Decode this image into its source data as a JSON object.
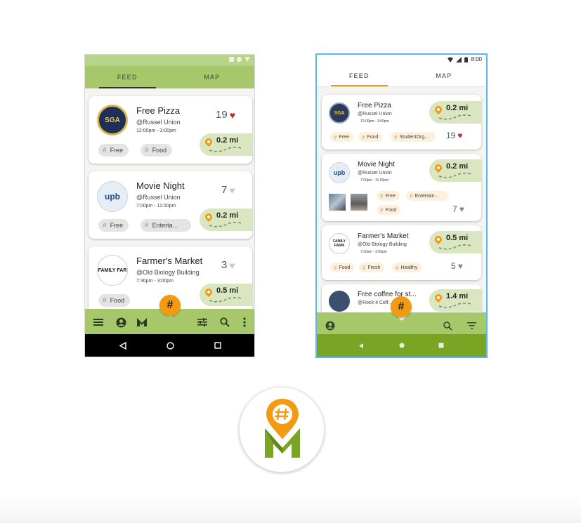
{
  "colors": {
    "accent_green": "#a6c86a",
    "orange": "#f29a12",
    "dark_green": "#7aa524",
    "like_red": "#c9242f",
    "selection_blue": "#5ab8ec"
  },
  "phone1": {
    "tabs": [
      {
        "label": "FEED",
        "active": true
      },
      {
        "label": "MAP",
        "active": false
      }
    ],
    "cards": [
      {
        "logo": "SGA",
        "title": "Free Pizza",
        "location": "@Russel Union",
        "time": "12:00pm - 3:00pm",
        "likes": "19",
        "liked": true,
        "distance": "0.2 mi",
        "tags": [
          "Free",
          "Food"
        ]
      },
      {
        "logo": "upb",
        "title": "Movie Night",
        "location": "@Russel Union",
        "time": "7:00pm - 11:00pm",
        "likes": "7",
        "liked": false,
        "distance": "0.2 mi",
        "tags": [
          "Free",
          "Enterta..."
        ]
      },
      {
        "logo": "FAMILY FAR",
        "title": "Farmer's Market",
        "location": "@Old Biology Building",
        "time": "7:30pm - 3:00pm",
        "likes": "3",
        "liked": false,
        "distance": "0.5 mi",
        "tags": [
          "Food"
        ]
      }
    ],
    "bottom_bar": {
      "icons": [
        "menu-icon",
        "account-icon",
        "m-logo-icon",
        "tune-icon",
        "search-icon",
        "more-vert-icon"
      ],
      "fab": "#"
    },
    "nav": [
      "back-icon",
      "home-icon",
      "recents-icon"
    ]
  },
  "phone2": {
    "status": {
      "time": "8:00"
    },
    "tabs": [
      {
        "label": "FEED",
        "active": true
      },
      {
        "label": "MAP",
        "active": false
      }
    ],
    "cards": [
      {
        "logo": "SGA",
        "title": "Free Pizza",
        "location": "@Russel Union",
        "time": "12:00pm - 3:00pm",
        "likes": "19",
        "liked": true,
        "distance": "0.2 mi",
        "tags": [
          "Free",
          "Food",
          "StudentOrg..."
        ]
      },
      {
        "logo": "upb",
        "title": "Movie Night",
        "location": "@Russel Union",
        "time": "7:00pm - 11:00pm",
        "likes": "7",
        "liked": false,
        "distance": "0.2 mi",
        "tags": [
          "Free",
          "Entertain...",
          "Food"
        ]
      },
      {
        "logo": "FAMILY FARM",
        "title": "Farmer's Market",
        "location": "@Old Biology Building",
        "time": "7:30am - 3:00pm",
        "likes": "5",
        "liked": false,
        "distance": "0.5 mi",
        "tags": [
          "Food",
          "Fresh",
          "Healthy"
        ]
      },
      {
        "logo": "",
        "title": "Free coffee for st...",
        "location": "@Rock-it Coff...",
        "distance": "1.4 mi"
      }
    ],
    "bottom_bar": {
      "icons": [
        "account-icon",
        "search-icon",
        "filter-icon"
      ],
      "fab": "#"
    },
    "nav": [
      "back-icon",
      "home-icon",
      "recents-icon"
    ]
  }
}
